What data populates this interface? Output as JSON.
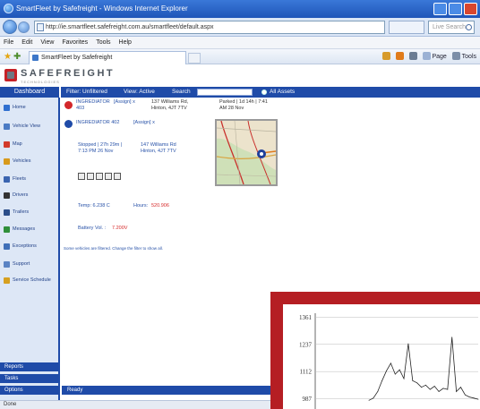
{
  "browser": {
    "title": "SmartFleet by Safefreight - Windows Internet Explorer",
    "url": "http://ie.smartfleet.safefreight.com.au/smartfleet/default.aspx",
    "search_placeholder": "Live Search",
    "menu": [
      "File",
      "Edit",
      "View",
      "Favorites",
      "Tools",
      "Help"
    ],
    "tab_label": "SmartFleet by Safefreight",
    "cmd_items": [
      "Page",
      "Tools"
    ]
  },
  "app": {
    "logo": "SAFEFREIGHT",
    "logo_sub": "TECHNOLOGIES",
    "nav": {
      "dashboard": "Dashboard",
      "filter": "Filter: Unfiltered",
      "view": "View: Active",
      "search_label": "Search",
      "all_assets": "All Assets"
    },
    "sidebar": [
      {
        "label": "Home",
        "icon": "home-icon",
        "color": "#2f6fd0"
      },
      {
        "label": "Vehicle View",
        "icon": "vehicle-view-icon",
        "color": "#4b7bc4"
      },
      {
        "label": "Map",
        "icon": "map-icon",
        "color": "#d23a2a"
      },
      {
        "label": "Vehicles",
        "icon": "truck-icon",
        "color": "#d89a1c"
      },
      {
        "label": "Fleets",
        "icon": "fleet-icon",
        "color": "#3a64b0"
      },
      {
        "label": "Drivers",
        "icon": "driver-icon",
        "color": "#333333"
      },
      {
        "label": "Trailers",
        "icon": "trailer-icon",
        "color": "#2b4e8a"
      },
      {
        "label": "Messages",
        "icon": "messages-icon",
        "color": "#2f8f3a"
      },
      {
        "label": "Exceptions",
        "icon": "exceptions-icon",
        "color": "#3f6fb8"
      },
      {
        "label": "Support",
        "icon": "support-icon",
        "color": "#5a83c4"
      },
      {
        "label": "Service Schedule",
        "icon": "service-schedule-icon",
        "color": "#d6a020"
      }
    ],
    "sidebar_bottom": [
      "Reports",
      "Tasks",
      "Options"
    ],
    "vehicles": [
      {
        "name": "INGREDIATOR",
        "id": "403",
        "assign": "[Assign] x",
        "address": "137 Williams Rd, Hinton, 4JT 7TV",
        "parked": "Parked | 1d 14h | 7:41 AM 28 Nov"
      },
      {
        "name": "INGREDIATOR 402",
        "assign": "[Assign] x",
        "stopped": "Stopped | 27h 29m |",
        "stopped_time": "7:13 PM 26 Nov",
        "address": "147 Williams Rd",
        "address2": "Hinton, 4JT 7TV",
        "temp": "Temp: 6.238 C",
        "hours": "Hours:",
        "hours_value": "520.906",
        "battery": "Battery Vol. :",
        "battery_value": "7.200V"
      }
    ],
    "footnote": "Some vehicles are filtered. Change the filter to show all.",
    "ready": "Ready"
  },
  "statusbar": {
    "text": "Done"
  },
  "chart_data": {
    "type": "line",
    "title": "",
    "xlabel": "",
    "ylabel": "",
    "y_ticks": [
      987,
      1112,
      1237,
      1361
    ],
    "ylim": [
      940,
      1380
    ],
    "series": [
      {
        "values": [
          980,
          990,
          1020,
          1070,
          1115,
          1150,
          1100,
          1120,
          1080,
          1240,
          1070,
          1060,
          1040,
          1050,
          1030,
          1045,
          1020,
          1035,
          1030,
          1270,
          1020,
          1040,
          1005,
          995,
          990,
          985
        ]
      }
    ]
  },
  "colors": {
    "nav_blue": "#1f4ba8",
    "sidebar_bg": "#dde7f6",
    "overlay_red": "#b51e23",
    "brand_red": "#c62127"
  }
}
